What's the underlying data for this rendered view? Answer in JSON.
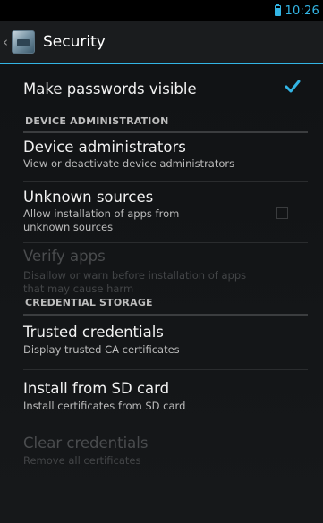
{
  "status_bar": {
    "time": "10:26",
    "battery_icon": "battery-icon",
    "accent_color": "#33b5e5"
  },
  "action_bar": {
    "up_caret": "‹",
    "app_icon": "settings-app-icon",
    "title": "Security"
  },
  "passwords": {
    "title": "Make passwords visible",
    "checked": true,
    "check_icon": "checkmark-icon"
  },
  "device_admin_header": "DEVICE ADMINISTRATION",
  "device_admins": {
    "title": "Device administrators",
    "summary": "View or deactivate device administrators"
  },
  "unknown_sources": {
    "title": "Unknown sources",
    "summary": "Allow installation of apps from unknown sources",
    "checked": false
  },
  "verify_apps": {
    "title": "Verify apps",
    "summary": "Disallow or warn before installation of apps that may cause harm",
    "enabled": false
  },
  "credential_header": "CREDENTIAL STORAGE",
  "trusted_credentials": {
    "title": "Trusted credentials",
    "summary": "Display trusted CA certificates"
  },
  "install_sd": {
    "title": "Install from SD card",
    "summary": "Install certificates from SD card"
  },
  "clear_credentials": {
    "title": "Clear credentials",
    "summary": "Remove all certificates",
    "enabled": false
  }
}
